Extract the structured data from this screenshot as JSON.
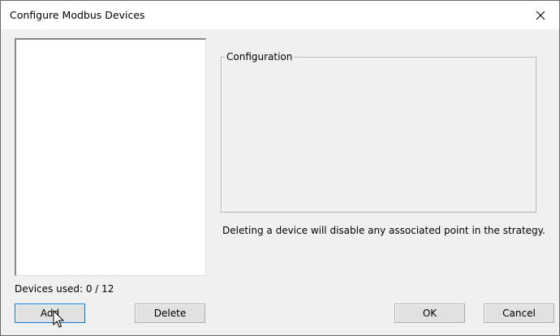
{
  "window": {
    "title": "Configure Modbus Devices",
    "close_icon": "close-icon"
  },
  "device_list": {
    "items": []
  },
  "configuration": {
    "group_label": "Configuration",
    "note": "Deleting a device will disable any associated point in the strategy."
  },
  "status": {
    "devices_used": "Devices used: 0 / 12"
  },
  "buttons": {
    "add_label": "Add",
    "delete_label": "Delete",
    "ok_label": "OK",
    "cancel_label": "Cancel"
  },
  "colors": {
    "focus_border": "#0078d7",
    "dialog_background": "#f0f0f0"
  }
}
